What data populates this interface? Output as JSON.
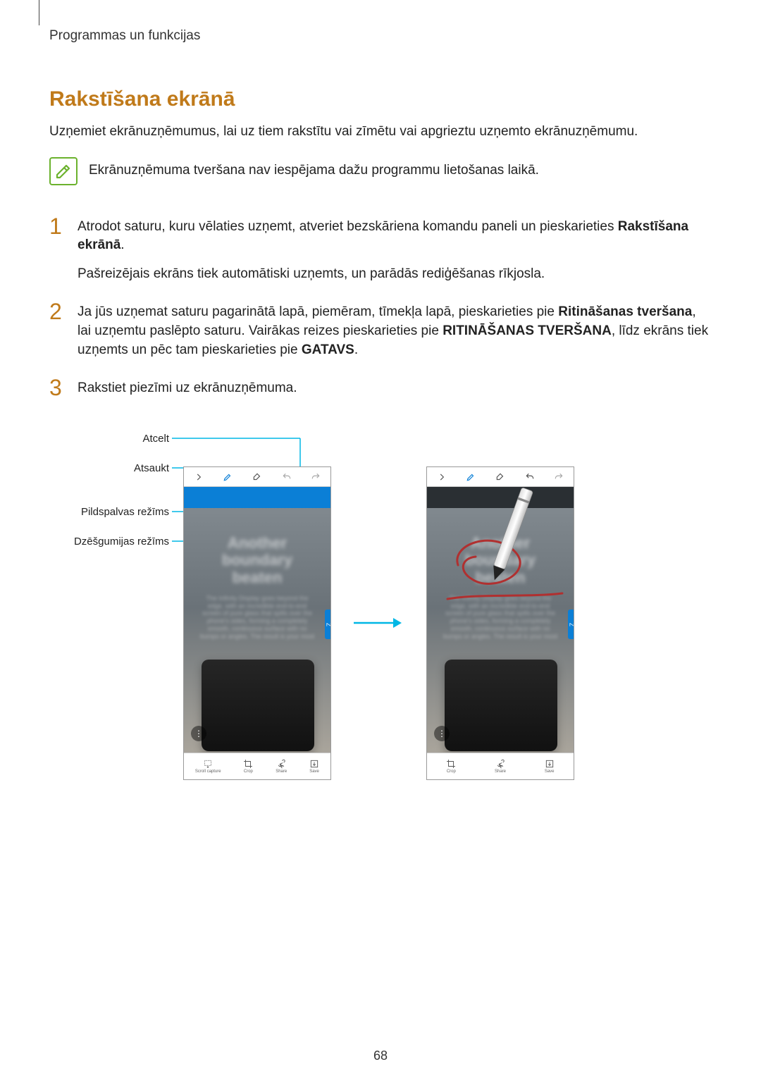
{
  "header": "Programmas un funkcijas",
  "section_title": "Rakstīšana ekrānā",
  "intro": "Uzņemiet ekrānuzņēmumus, lai uz tiem rakstītu vai zīmētu vai apgrieztu uzņemto ekrānuzņēmumu.",
  "note": "Ekrānuzņēmuma tveršana nav iespējama dažu programmu lietošanas laikā.",
  "steps": {
    "s1n": "1",
    "s1a_pre": "Atrodot saturu, kuru vēlaties uzņemt, atveriet bezskāriena komandu paneli un pieskarieties ",
    "s1a_strong": "Rakstīšana ekrānā",
    "s1a_post": ".",
    "s1b": "Pašreizējais ekrāns tiek automātiski uzņemts, un parādās rediģēšanas rīkjosla.",
    "s2n": "2",
    "s2_pre": "Ja jūs uzņemat saturu pagarinātā lapā, piemēram, tīmekļa lapā, pieskarieties pie ",
    "s2_b1": "Ritināšanas tveršana",
    "s2_mid1": ", lai uzņemtu paslēpto saturu. Vairākas reizes pieskarieties pie ",
    "s2_b2": "RITINĀŠANAS TVERŠANA",
    "s2_mid2": ", līdz ekrāns tiek uzņemts un pēc tam pieskarieties pie ",
    "s2_b3": "GATAVS",
    "s2_post": ".",
    "s3n": "3",
    "s3": "Rakstiet piezīmi uz ekrānuzņēmuma."
  },
  "labels": {
    "l1": "Atcelt",
    "l2": "Atsaukt",
    "l3": "Pildspalvas režīms",
    "l4": "Dzēšgumijas režīms"
  },
  "phone": {
    "title1": "Another",
    "title2": "boundary",
    "title3": "beaten",
    "small": "The Infinity Display goes beyond the edge, with an incredible end-to-end screen of pure glass that spills over the phone's sides, forming a completely smooth, continuous surface with no bumps or angles. The result is your most"
  },
  "bottom_icons": {
    "scroll": "Scroll capture",
    "crop": "Crop",
    "share": "Share",
    "save": "Save"
  },
  "page_number": "68"
}
